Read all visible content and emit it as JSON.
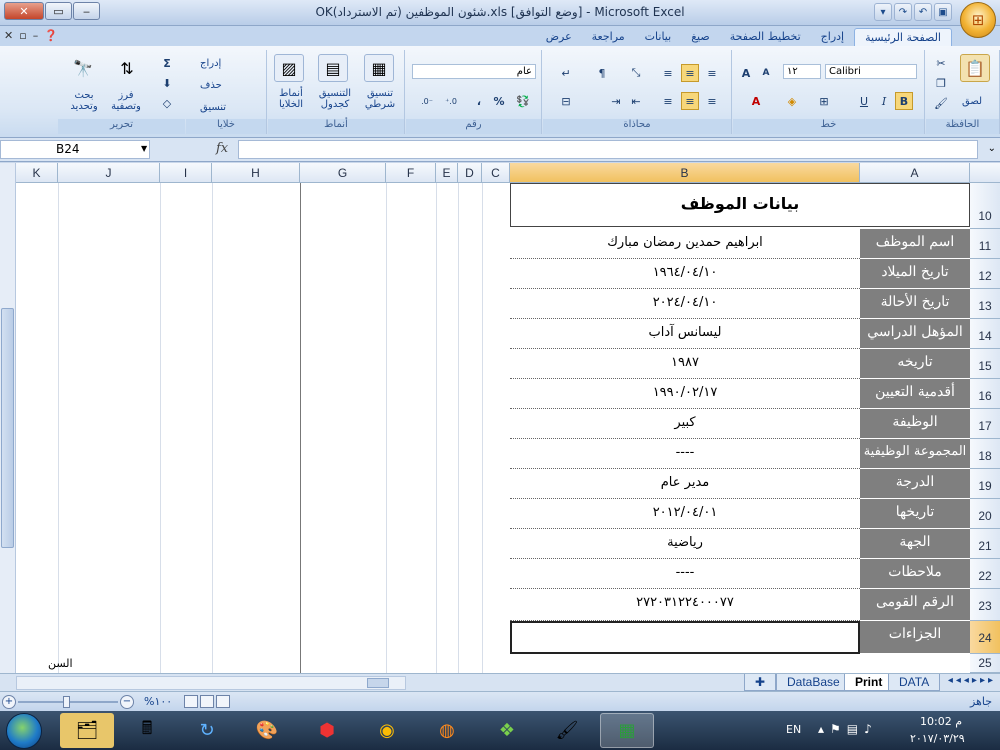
{
  "window": {
    "title": "OKشئون الموظفين (تم الاسترداد).xls  [وضع التوافق] - Microsoft Excel",
    "minimize_icon": "minimize-icon",
    "maximize_icon": "maximize-icon",
    "close_icon": "close-icon"
  },
  "ribbon_tabs": [
    "الصفحة الرئيسية",
    "إدراج",
    "تخطيط الصفحة",
    "صيغ",
    "بيانات",
    "مراجعة",
    "عرض"
  ],
  "ribbon": {
    "clipboard": {
      "label": "الحافظة",
      "paste": "لصق"
    },
    "font": {
      "label": "خط",
      "font_name": "Calibri",
      "font_size": "١٢",
      "bold": "B",
      "italic": "I",
      "underline": "U",
      "grow": "A",
      "shrink": "A"
    },
    "alignment": {
      "label": "محاذاة"
    },
    "number": {
      "label": "رقم",
      "format": "عام",
      "percent": "%",
      "comma": "،",
      "inc_decimal": ".00 ←.0",
      "dec_decimal": ".0 →.00"
    },
    "styles": {
      "label": "أنماط",
      "conditional": "تنسيق شرطي",
      "table": "التنسيق كجدول",
      "cell": "أنماط الخلايا"
    },
    "cells": {
      "label": "خلايا",
      "insert": "إدراج",
      "delete": "حذف",
      "format": "تنسيق"
    },
    "editing": {
      "label": "تحرير",
      "autosum": "Σ",
      "sort": "فرز وتصفية",
      "find": "بحث وتحديد"
    }
  },
  "formula_bar": {
    "name_box": "B24",
    "fx": "fx",
    "value": ""
  },
  "columns": [
    "K",
    "J",
    "I",
    "H",
    "G",
    "F",
    "E",
    "D",
    "C",
    "B",
    "A"
  ],
  "selected_column": "B",
  "sheet": {
    "header_row": "10",
    "header": "بيانات الموظف",
    "rows": [
      {
        "row": "11",
        "label": "اسم الموظف",
        "value": "ابراهيم حمدين رمضان مبارك"
      },
      {
        "row": "12",
        "label": "تاريخ الميلاد",
        "value": "١٩٦٤/٠٤/١٠"
      },
      {
        "row": "13",
        "label": "تاريخ الأحالة",
        "value": "٢٠٢٤/٠٤/١٠"
      },
      {
        "row": "14",
        "label": "المؤهل الدراسي",
        "value": "ليسانس آداب"
      },
      {
        "row": "15",
        "label": "تاريخه",
        "value": "١٩٨٧"
      },
      {
        "row": "16",
        "label": "أقدمية التعيين",
        "value": "١٩٩٠/٠٢/١٧"
      },
      {
        "row": "17",
        "label": "الوظيفة",
        "value": "كبير"
      },
      {
        "row": "18",
        "label": "المجموعة الوظيفية",
        "value": "----"
      },
      {
        "row": "19",
        "label": "الدرجة",
        "value": "مدير عام"
      },
      {
        "row": "20",
        "label": "تاريخها",
        "value": "٢٠١٢/٠٤/٠١"
      },
      {
        "row": "21",
        "label": "الجهة",
        "value": "رياضية"
      },
      {
        "row": "22",
        "label": "ملاحظات",
        "value": "----"
      },
      {
        "row": "23",
        "label": "الرقم القومى",
        "value": "٢٧٢٠٣١٢٢٤٠٠٠٧٧"
      },
      {
        "row": "24",
        "label": "الجزاءات",
        "value": ""
      }
    ],
    "last_row": "25",
    "side_label": "السن"
  },
  "sheet_tabs": [
    "DATA",
    "Print",
    "DataBase"
  ],
  "active_sheet_tab": "Print",
  "status": {
    "ready": "جاهز",
    "zoom": "%١٠٠"
  },
  "taskbar": {
    "lang": "EN",
    "time": "10:02 م",
    "date": "٢٠١٧/٠٣/٢٩"
  }
}
